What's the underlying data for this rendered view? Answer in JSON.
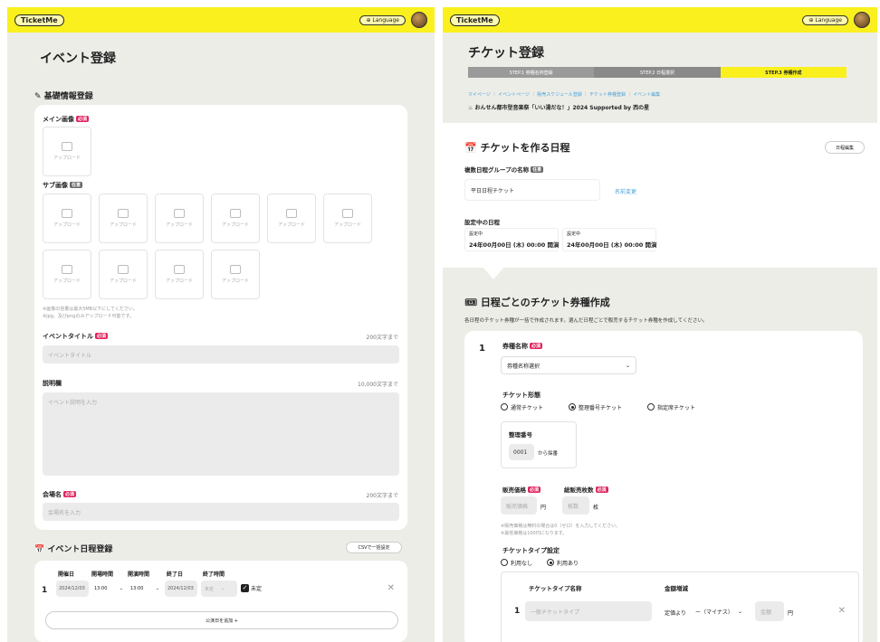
{
  "left": {
    "logo": "TicketMe",
    "language_label": "Language",
    "page_title": "イベント登録",
    "basic_info_title": "基礎情報登録",
    "main_image_label": "メイン画像",
    "required_badge": "必須",
    "optional_badge": "任意",
    "upload_label": "アップロード",
    "sub_image_label": "サブ画像",
    "image_note_1": "※画像の容量は最大5MB以下にしてください。",
    "image_note_2": "※jpg、及びpngのみアップロード可能です。",
    "event_title_label": "イベントタイトル",
    "event_title_limit": "200文字まで",
    "event_title_placeholder": "イベントタイトル",
    "description_label": "説明欄",
    "description_limit": "10,000文字まで",
    "description_placeholder": "イベント説明を入力",
    "venue_label": "会場名",
    "venue_limit": "200文字まで",
    "venue_placeholder": "会場名を入力",
    "schedule_title": "イベント日程登録",
    "csv_button": "CSVで一括設定",
    "cols": {
      "start_date": "開催日",
      "open_time": "開場時間",
      "start_time": "開演時間",
      "end_date": "終了日",
      "end_time": "終了時間"
    },
    "row_number": "1",
    "row": {
      "start_date": "2024/12/03",
      "open_time": "13:00",
      "start_time": "13:00",
      "end_date": "2024/12/03",
      "end_time": "未定",
      "undecided": "未定"
    },
    "add_date_button": "公演日を追加 +"
  },
  "right": {
    "logo": "TicketMe",
    "language_label": "Language",
    "page_title": "チケット登録",
    "steps": [
      "STEP.1 券種名称登録",
      "STEP.2 日程選択",
      "STEP.3 券種作成"
    ],
    "crumbs": [
      "マイページ",
      "イベントページ",
      "販売スケジュール登録",
      "チケット券種登録",
      "イベント編集"
    ],
    "event_name": "おんせん都市型音楽祭「いい湯だな！」2024 Supported by 西の星",
    "ticket_dates_title": "チケットを作る日程",
    "edit_dates_button": "日程編集",
    "group_name_label": "複数日程グループの名称",
    "optional_badge": "任意",
    "group_name_value": "平日日程チケット",
    "change_name_link": "名前変更",
    "selected_dates_label": "設定中の日程",
    "date_tags": [
      {
        "status": "設定中",
        "date": "24年00月00日 (木) 00:00 開演"
      },
      {
        "status": "設定中",
        "date": "24年00月00日 (木) 00:00 開演"
      }
    ],
    "per_date_title": "日程ごとのチケット券種作成",
    "per_date_desc": "各日程のチケット券種が一括で作成されます。選んだ日程ごとで販売するチケット券種を作成してください。",
    "item_number": "1",
    "ticket_name_label": "券種名称",
    "required_badge": "必須",
    "ticket_name_select": "券種名称選択",
    "ticket_form_label": "チケット形態",
    "form_options": [
      "通常チケット",
      "整理番号チケット",
      "指定席チケット"
    ],
    "form_selected_index": 1,
    "serial_label": "整理番号",
    "serial_value": "0001",
    "serial_suffix": "から採番",
    "price_label": "販売価格",
    "total_label": "総販売枚数",
    "price_placeholder": "販売価格",
    "price_unit": "円",
    "total_placeholder": "枚数",
    "total_unit": "枚",
    "price_note_1": "※販売価格は無料の場合は0（ゼロ）を入力してください。",
    "price_note_2": "※最低価格は100円になります。",
    "type_setting_label": "チケットタイプ設定",
    "type_options": [
      "利用なし",
      "利用あり"
    ],
    "type_selected_index": 1,
    "type_name_col": "チケットタイプ名称",
    "amount_col": "金額増減",
    "type_row_number": "1",
    "type_name_placeholder": "一般チケットタイプ",
    "fixed_price_label": "定価より",
    "minus_select": "ー（マイナス）",
    "amount_placeholder": "金額",
    "amount_unit": "円"
  }
}
